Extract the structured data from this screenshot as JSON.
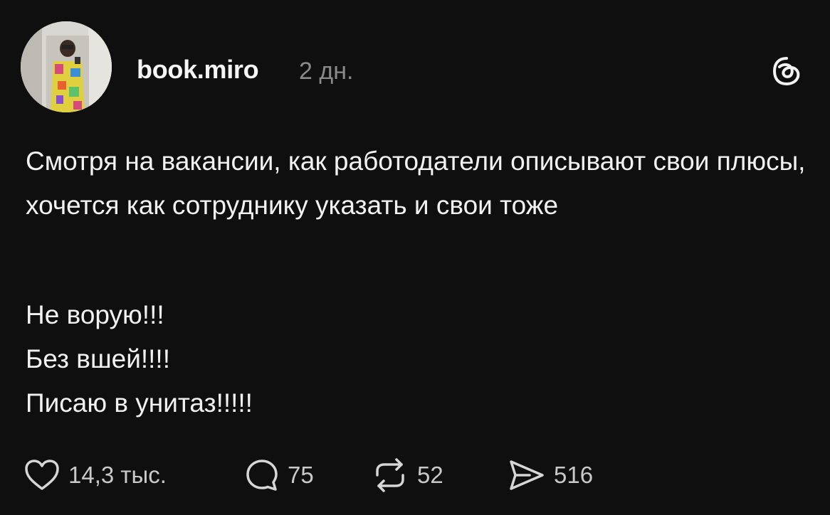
{
  "author": {
    "username": "book.miro",
    "time_ago": "2 дн."
  },
  "post": {
    "paragraph1": "Смотря на вакансии, как работодатели описывают свои плюсы, хочется как сотруднику указать и свои тоже",
    "lines": [
      "Не ворую!!!",
      "Без вшей!!!!",
      "Писаю в унитаз!!!!!"
    ]
  },
  "actions": {
    "likes": "14,3 тыс.",
    "replies": "75",
    "reposts": "52",
    "shares": "516"
  },
  "icons": {
    "like": "heart-icon",
    "reply": "comment-icon",
    "repost": "repost-icon",
    "share": "send-icon",
    "brand": "threads-logo-icon"
  },
  "colors": {
    "background": "#0f0f0f",
    "text": "#f1f1f1",
    "muted": "#8a8a8a"
  }
}
